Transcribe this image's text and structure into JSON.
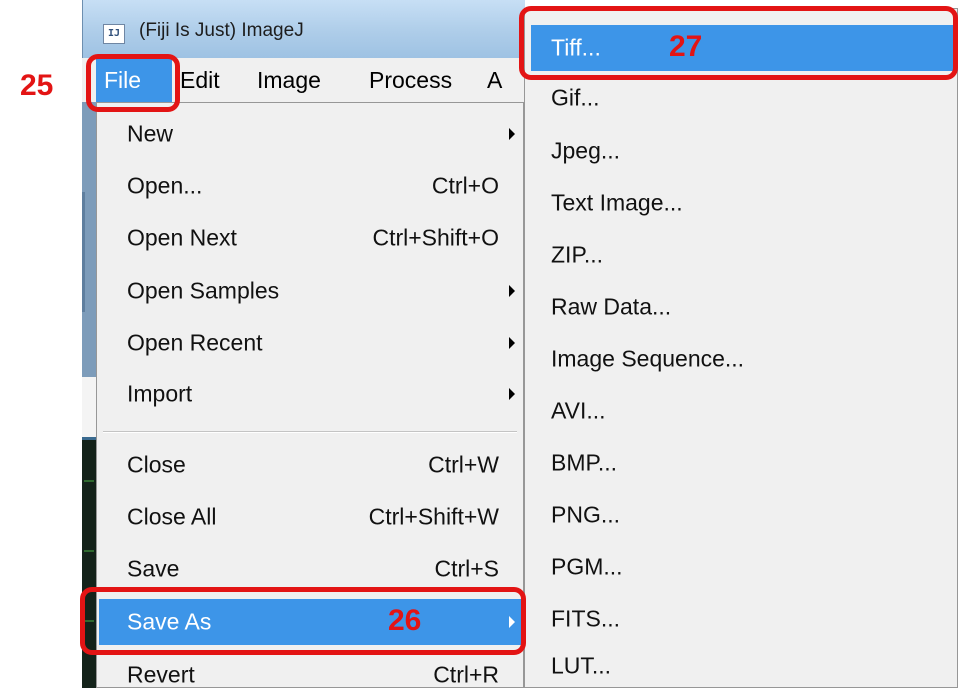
{
  "window": {
    "title": "(Fiji Is Just) ImageJ",
    "icon": "imagej-app-icon",
    "icon_glyph": "IJ"
  },
  "menubar": {
    "items": [
      "File",
      "Edit",
      "Image",
      "Process",
      "A"
    ],
    "active": "File"
  },
  "file_menu": {
    "items": [
      {
        "label": "New",
        "shortcut": "",
        "submenu": true
      },
      {
        "label": "Open...",
        "shortcut": "Ctrl+O",
        "submenu": false
      },
      {
        "label": "Open Next",
        "shortcut": "Ctrl+Shift+O",
        "submenu": false
      },
      {
        "label": "Open Samples",
        "shortcut": "",
        "submenu": true
      },
      {
        "label": "Open Recent",
        "shortcut": "",
        "submenu": true
      },
      {
        "label": "Import",
        "shortcut": "",
        "submenu": true
      },
      {
        "label": "Close",
        "shortcut": "Ctrl+W",
        "submenu": false
      },
      {
        "label": "Close All",
        "shortcut": "Ctrl+Shift+W",
        "submenu": false
      },
      {
        "label": "Save",
        "shortcut": "Ctrl+S",
        "submenu": false
      },
      {
        "label": "Save As",
        "shortcut": "",
        "submenu": true,
        "highlighted": true
      },
      {
        "label": "Revert",
        "shortcut": "Ctrl+R",
        "submenu": false
      }
    ]
  },
  "save_as_menu": {
    "items": [
      {
        "label": "Tiff...",
        "highlighted": true
      },
      {
        "label": "Gif..."
      },
      {
        "label": "Jpeg..."
      },
      {
        "label": "Text Image..."
      },
      {
        "label": "ZIP..."
      },
      {
        "label": "Raw Data..."
      },
      {
        "label": "Image Sequence..."
      },
      {
        "label": "AVI..."
      },
      {
        "label": "BMP..."
      },
      {
        "label": "PNG..."
      },
      {
        "label": "PGM..."
      },
      {
        "label": "FITS..."
      },
      {
        "label": "LUT..."
      }
    ]
  },
  "annotations": [
    {
      "number": "25",
      "target": "File menu"
    },
    {
      "number": "26",
      "target": "Save As"
    },
    {
      "number": "27",
      "target": "Tiff..."
    }
  ],
  "colors": {
    "highlight": "#3d95e8",
    "annotation_red": "#e31414",
    "menu_background": "#f0f0f0",
    "titlebar": "#aecde9"
  }
}
